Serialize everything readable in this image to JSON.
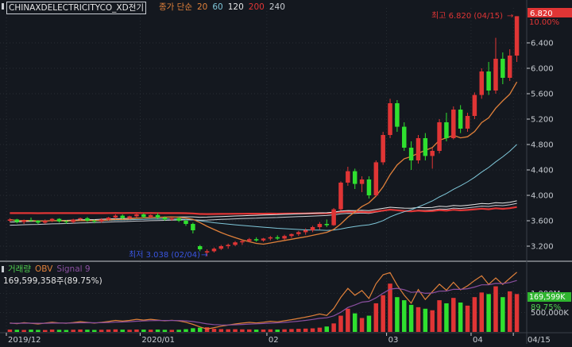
{
  "title": "CHINAXDELECTRICITYCO_XD전기",
  "price_legend": {
    "label": "종가 단순",
    "periods": [
      {
        "text": "20",
        "color": "#e0803a"
      },
      {
        "text": "60",
        "color": "#7fc7d9"
      },
      {
        "text": "120",
        "color": "#e6e6e6"
      },
      {
        "text": "200",
        "color": "#e03535"
      },
      {
        "text": "240",
        "color": "#c8ccd2"
      }
    ],
    "label_color": "#e0803a"
  },
  "volume_legend": {
    "items": [
      {
        "text": "거래량",
        "color": "#4fd04f"
      },
      {
        "text": "OBV",
        "color": "#e0803a"
      },
      {
        "text": "Signal 9",
        "color": "#8a4fa0"
      }
    ],
    "value": "169,599,358주(89.75%)"
  },
  "annotations": {
    "high": "최고 6.820 (04/15)",
    "low": "최저 3.038 (02/04)",
    "high_pct": "10.00%"
  },
  "price_axis": {
    "labels": [
      "6.400",
      "6.000",
      "5.600",
      "5.200",
      "4.800",
      "4.400",
      "4.000",
      "3.600",
      "3.200"
    ],
    "last_price": "6.820"
  },
  "volume_axis": {
    "labels": [
      "1,000M",
      "500,000K"
    ],
    "current_value": "169,599K",
    "current_pct": "89.75%"
  },
  "date_axis": {
    "labels": [
      "2019/12",
      "2020/01",
      "02",
      "03",
      "04",
      "04/15"
    ]
  },
  "colors": {
    "up": "#e03535",
    "down": "#2fe02f",
    "background": "#14181f",
    "grid": "#3a4048"
  },
  "chart_data": {
    "type": "candlestick",
    "title": "",
    "ylim": [
      3.0,
      6.95
    ],
    "volume_ylim": [
      0,
      1500
    ],
    "volume_unit": "M",
    "candles": [
      [
        3.6,
        3.64,
        3.58,
        3.62,
        60
      ],
      [
        3.62,
        3.63,
        3.56,
        3.58,
        55
      ],
      [
        3.58,
        3.62,
        3.55,
        3.61,
        50
      ],
      [
        3.61,
        3.65,
        3.58,
        3.6,
        58
      ],
      [
        3.6,
        3.61,
        3.55,
        3.57,
        52
      ],
      [
        3.57,
        3.62,
        3.55,
        3.6,
        49
      ],
      [
        3.6,
        3.64,
        3.58,
        3.63,
        60
      ],
      [
        3.63,
        3.64,
        3.57,
        3.59,
        54
      ],
      [
        3.59,
        3.61,
        3.55,
        3.58,
        50
      ],
      [
        3.58,
        3.63,
        3.56,
        3.62,
        56
      ],
      [
        3.62,
        3.65,
        3.6,
        3.64,
        62
      ],
      [
        3.64,
        3.66,
        3.58,
        3.6,
        57
      ],
      [
        3.6,
        3.62,
        3.56,
        3.59,
        51
      ],
      [
        3.59,
        3.64,
        3.57,
        3.62,
        55
      ],
      [
        3.62,
        3.66,
        3.6,
        3.65,
        60
      ],
      [
        3.65,
        3.7,
        3.63,
        3.68,
        66
      ],
      [
        3.68,
        3.7,
        3.62,
        3.64,
        58
      ],
      [
        3.64,
        3.68,
        3.62,
        3.67,
        55
      ],
      [
        3.67,
        3.72,
        3.65,
        3.7,
        62
      ],
      [
        3.7,
        3.72,
        3.64,
        3.66,
        59
      ],
      [
        3.66,
        3.7,
        3.64,
        3.69,
        57
      ],
      [
        3.69,
        3.72,
        3.63,
        3.65,
        60
      ],
      [
        3.65,
        3.67,
        3.6,
        3.62,
        54
      ],
      [
        3.62,
        3.66,
        3.6,
        3.64,
        52
      ],
      [
        3.64,
        3.66,
        3.58,
        3.6,
        55
      ],
      [
        3.6,
        3.62,
        3.52,
        3.55,
        70
      ],
      [
        3.55,
        3.57,
        3.4,
        3.45,
        95
      ],
      [
        3.2,
        3.22,
        3.12,
        3.15,
        110
      ],
      [
        3.1,
        3.15,
        3.04,
        3.12,
        120
      ],
      [
        3.12,
        3.18,
        3.1,
        3.16,
        80
      ],
      [
        3.16,
        3.22,
        3.14,
        3.2,
        72
      ],
      [
        3.2,
        3.24,
        3.16,
        3.22,
        68
      ],
      [
        3.22,
        3.28,
        3.2,
        3.26,
        70
      ],
      [
        3.26,
        3.3,
        3.22,
        3.28,
        66
      ],
      [
        3.28,
        3.33,
        3.26,
        3.31,
        64
      ],
      [
        3.31,
        3.34,
        3.27,
        3.29,
        60
      ],
      [
        3.29,
        3.33,
        3.27,
        3.32,
        62
      ],
      [
        3.32,
        3.36,
        3.29,
        3.34,
        66
      ],
      [
        3.34,
        3.37,
        3.3,
        3.32,
        60
      ],
      [
        3.32,
        3.38,
        3.3,
        3.36,
        68
      ],
      [
        3.36,
        3.4,
        3.33,
        3.39,
        74
      ],
      [
        3.39,
        3.44,
        3.36,
        3.42,
        80
      ],
      [
        3.42,
        3.48,
        3.38,
        3.45,
        86
      ],
      [
        3.45,
        3.52,
        3.42,
        3.5,
        92
      ],
      [
        3.5,
        3.58,
        3.46,
        3.55,
        110
      ],
      [
        3.55,
        3.62,
        3.5,
        3.53,
        140
      ],
      [
        3.53,
        3.8,
        3.52,
        3.78,
        220
      ],
      [
        3.78,
        4.22,
        3.76,
        4.2,
        420
      ],
      [
        4.2,
        4.45,
        4.15,
        4.38,
        600
      ],
      [
        4.38,
        4.42,
        4.1,
        4.18,
        480
      ],
      [
        4.18,
        4.3,
        4.05,
        4.25,
        360
      ],
      [
        4.25,
        4.3,
        3.95,
        4.0,
        420
      ],
      [
        4.0,
        4.55,
        3.98,
        4.52,
        740
      ],
      [
        4.52,
        5.0,
        4.48,
        4.95,
        950
      ],
      [
        4.95,
        5.52,
        4.9,
        5.45,
        1250
      ],
      [
        5.45,
        5.5,
        5.0,
        5.08,
        900
      ],
      [
        5.08,
        5.15,
        4.7,
        4.75,
        820
      ],
      [
        4.75,
        4.85,
        4.4,
        4.55,
        700
      ],
      [
        4.55,
        4.95,
        4.5,
        4.9,
        640
      ],
      [
        4.9,
        4.98,
        4.55,
        4.62,
        600
      ],
      [
        4.62,
        4.75,
        4.42,
        4.7,
        560
      ],
      [
        4.7,
        5.2,
        4.66,
        5.15,
        820
      ],
      [
        5.15,
        5.3,
        4.85,
        4.9,
        740
      ],
      [
        4.9,
        5.4,
        4.88,
        5.35,
        880
      ],
      [
        5.35,
        5.42,
        4.98,
        5.05,
        760
      ],
      [
        5.05,
        5.3,
        5.0,
        5.25,
        680
      ],
      [
        5.25,
        5.62,
        5.2,
        5.58,
        900
      ],
      [
        5.58,
        6.0,
        5.52,
        5.95,
        1020
      ],
      [
        5.95,
        6.1,
        5.58,
        5.65,
        980
      ],
      [
        5.65,
        6.48,
        5.6,
        6.15,
        1180
      ],
      [
        6.15,
        6.25,
        5.75,
        5.85,
        900
      ],
      [
        5.85,
        6.3,
        5.8,
        6.2,
        1050
      ],
      [
        6.2,
        6.82,
        6.1,
        6.82,
        980
      ]
    ],
    "obv": [
      50,
      30,
      55,
      40,
      20,
      45,
      70,
      50,
      40,
      60,
      85,
      65,
      45,
      65,
      90,
      120,
      100,
      120,
      150,
      130,
      150,
      130,
      110,
      125,
      105,
      70,
      10,
      -60,
      -120,
      -80,
      -40,
      -10,
      20,
      45,
      65,
      50,
      70,
      95,
      80,
      110,
      140,
      175,
      210,
      250,
      300,
      260,
      450,
      760,
      1010,
      820,
      950,
      730,
      1140,
      1390,
      1450,
      1100,
      820,
      600,
      980,
      700,
      920,
      1130,
      960,
      1180,
      970,
      1080,
      1230,
      1360,
      1120,
      1300,
      1120,
      1290,
      1460
    ],
    "signal": [
      40,
      40,
      42,
      42,
      40,
      41,
      45,
      46,
      45,
      48,
      54,
      56,
      54,
      56,
      62,
      71,
      77,
      85,
      98,
      105,
      114,
      118,
      117,
      119,
      116,
      107,
      88,
      59,
      24,
      4,
      -6,
      -7,
      -2,
      8,
      19,
      25,
      34,
      46,
      53,
      64,
      80,
      99,
      121,
      147,
      178,
      194,
      245,
      348,
      480,
      548,
      629,
      649,
      747,
      876,
      991,
      1013,
      974,
      899,
      915,
      872,
      882,
      932,
      938,
      986,
      983,
      1002,
      1048,
      1110,
      1112,
      1150,
      1144,
      1173,
      1231
    ]
  }
}
